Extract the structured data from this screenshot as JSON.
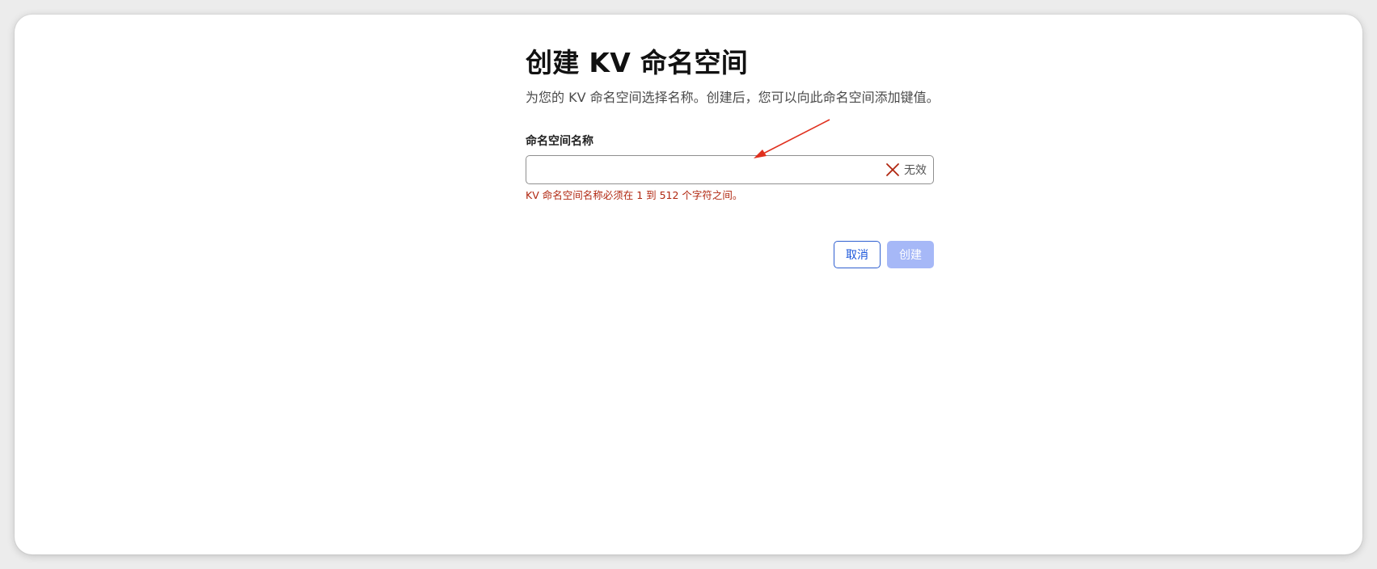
{
  "dialog": {
    "title": "创建 KV 命名空间",
    "subtitle": "为您的 KV 命名空间选择名称。创建后，您可以向此命名空间添加键值。",
    "field_label": "命名空间名称",
    "field_value": "",
    "invalid_label": "无效",
    "error_message": "KV 命名空间名称必须在 1 到 512 个字符之间。",
    "cancel_label": "取消",
    "create_label": "创建"
  },
  "colors": {
    "primary": "#1a56db",
    "disabled_primary": "#a6b8f7",
    "error": "#b0260f",
    "annotation_arrow": "#e0301e"
  },
  "icons": {
    "invalid": "close-x-icon",
    "annotation": "red-arrow-annotation"
  }
}
